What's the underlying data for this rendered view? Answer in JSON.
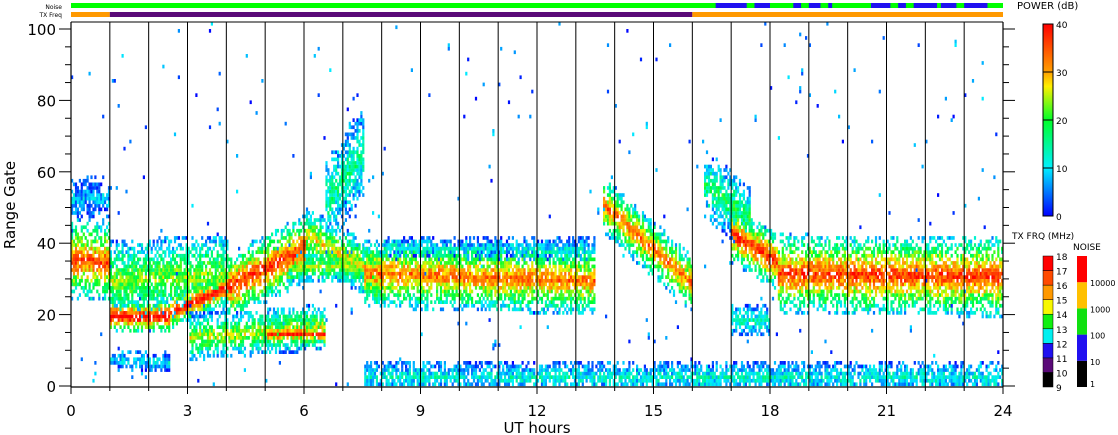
{
  "chart_data": {
    "type": "heatmap",
    "title": "",
    "xlabel": "UT hours",
    "ylabel": "Range Gate",
    "xlim": [
      0,
      24
    ],
    "ylim": [
      0,
      102
    ],
    "x_ticks": [
      "0",
      "3",
      "6",
      "9",
      "12",
      "15",
      "18",
      "21",
      "24"
    ],
    "y_ticks": [
      "0",
      "20",
      "40",
      "60",
      "80",
      "100"
    ],
    "grid": "vertical lines every hour",
    "top_bars": {
      "noise_label": "Noise",
      "txfreq_label": "TX Freq",
      "noise_blue_segments_hours": [
        [
          16.6,
          17.4
        ],
        [
          17.6,
          18.0
        ],
        [
          18.6,
          18.8
        ],
        [
          19.0,
          19.3
        ],
        [
          19.5,
          19.6
        ],
        [
          20.6,
          21.1
        ],
        [
          21.3,
          21.5
        ],
        [
          21.7,
          22.3
        ],
        [
          22.4,
          22.8
        ],
        [
          23.0,
          23.6
        ]
      ],
      "txfreq_segments": [
        {
          "from": 0,
          "to": 1,
          "mhz": 15
        },
        {
          "from": 1,
          "to": 16,
          "mhz": 10
        },
        {
          "from": 16,
          "to": 24,
          "mhz": 15
        }
      ]
    },
    "power_features": [
      {
        "t0": 0.0,
        "t1": 1.0,
        "g0": 35,
        "g1": 34,
        "hw": 7,
        "power": 36
      },
      {
        "t0": 0.0,
        "t1": 1.0,
        "g0": 52,
        "g1": 52,
        "hw": 4,
        "power": 8
      },
      {
        "t0": 1.0,
        "t1": 2.5,
        "g0": 19,
        "g1": 19,
        "hw": 3,
        "power": 42
      },
      {
        "t0": 2.5,
        "t1": 4.0,
        "g0": 20,
        "g1": 27,
        "hw": 3,
        "power": 40
      },
      {
        "t0": 1.0,
        "t1": 4.0,
        "g0": 29,
        "g1": 31,
        "hw": 7,
        "power": 24
      },
      {
        "t0": 1.0,
        "t1": 2.5,
        "g0": 7,
        "g1": 6,
        "hw": 2,
        "power": 10
      },
      {
        "t0": 4.0,
        "t1": 6.0,
        "g0": 27,
        "g1": 38,
        "hw": 6,
        "power": 38
      },
      {
        "t0": 6.0,
        "t1": 8.0,
        "g0": 42,
        "g1": 30,
        "hw": 5,
        "power": 28
      },
      {
        "t0": 6.5,
        "t1": 7.5,
        "g0": 50,
        "g1": 65,
        "hw": 8,
        "power": 16
      },
      {
        "t0": 3.0,
        "t1": 6.5,
        "g0": 13,
        "g1": 16,
        "hw": 4,
        "power": 26
      },
      {
        "t0": 5.0,
        "t1": 6.5,
        "g0": 14,
        "g1": 14,
        "hw": 2,
        "power": 38
      },
      {
        "t0": 5.5,
        "t1": 7.5,
        "g0": 33,
        "g1": 33,
        "hw": 3,
        "power": 24
      },
      {
        "t0": 7.5,
        "t1": 13.5,
        "g0": 31,
        "g1": 29,
        "hw": 6,
        "power": 34
      },
      {
        "t0": 8.0,
        "t1": 13.5,
        "g0": 38,
        "g1": 38,
        "hw": 2,
        "power": 10
      },
      {
        "t0": 13.7,
        "t1": 16.0,
        "g0": 50,
        "g1": 28,
        "hw": 5,
        "power": 34
      },
      {
        "t0": 16.3,
        "t1": 17.5,
        "g0": 56,
        "g1": 46,
        "hw": 6,
        "power": 18
      },
      {
        "t0": 17.0,
        "t1": 18.2,
        "g0": 42,
        "g1": 34,
        "hw": 5,
        "power": 38
      },
      {
        "t0": 18.2,
        "t1": 24.0,
        "g0": 31,
        "g1": 30,
        "hw": 7,
        "power": 37
      },
      {
        "t0": 17.0,
        "t1": 18.0,
        "g0": 18,
        "g1": 18,
        "hw": 3,
        "power": 14
      },
      {
        "t0": 7.5,
        "t1": 24.0,
        "g0": 2,
        "g1": 2,
        "hw": 3,
        "power": 12
      }
    ],
    "colorbars": {
      "power": {
        "title": "POWER (dB)",
        "ticks": [
          "40",
          "30",
          "20",
          "10",
          "0"
        ],
        "range": [
          0,
          40
        ]
      },
      "txfreq": {
        "title": "TX FRQ (MHz)",
        "ticks": [
          "18",
          "17",
          "16",
          "15",
          "14",
          "13",
          "12",
          "11",
          "10",
          "9"
        ],
        "colors": [
          "#000000",
          "#5a0a78",
          "#2010f0",
          "#00f0f0",
          "#10f010",
          "#f8f800",
          "#ff9900",
          "#ff4a00",
          "#ff0000"
        ]
      },
      "noise": {
        "title": "NOISE",
        "ticks": [
          "10000",
          "1000",
          "100",
          "10",
          "1"
        ],
        "colors": [
          "#000000",
          "#2010f0",
          "#10e010",
          "#ffc000",
          "#ff0000"
        ]
      }
    },
    "colors": {
      "noise_ok": "#00ff00",
      "noise_high": "#2010f0",
      "tx_low": "#5a0a78",
      "tx_high": "#ff9900"
    }
  }
}
